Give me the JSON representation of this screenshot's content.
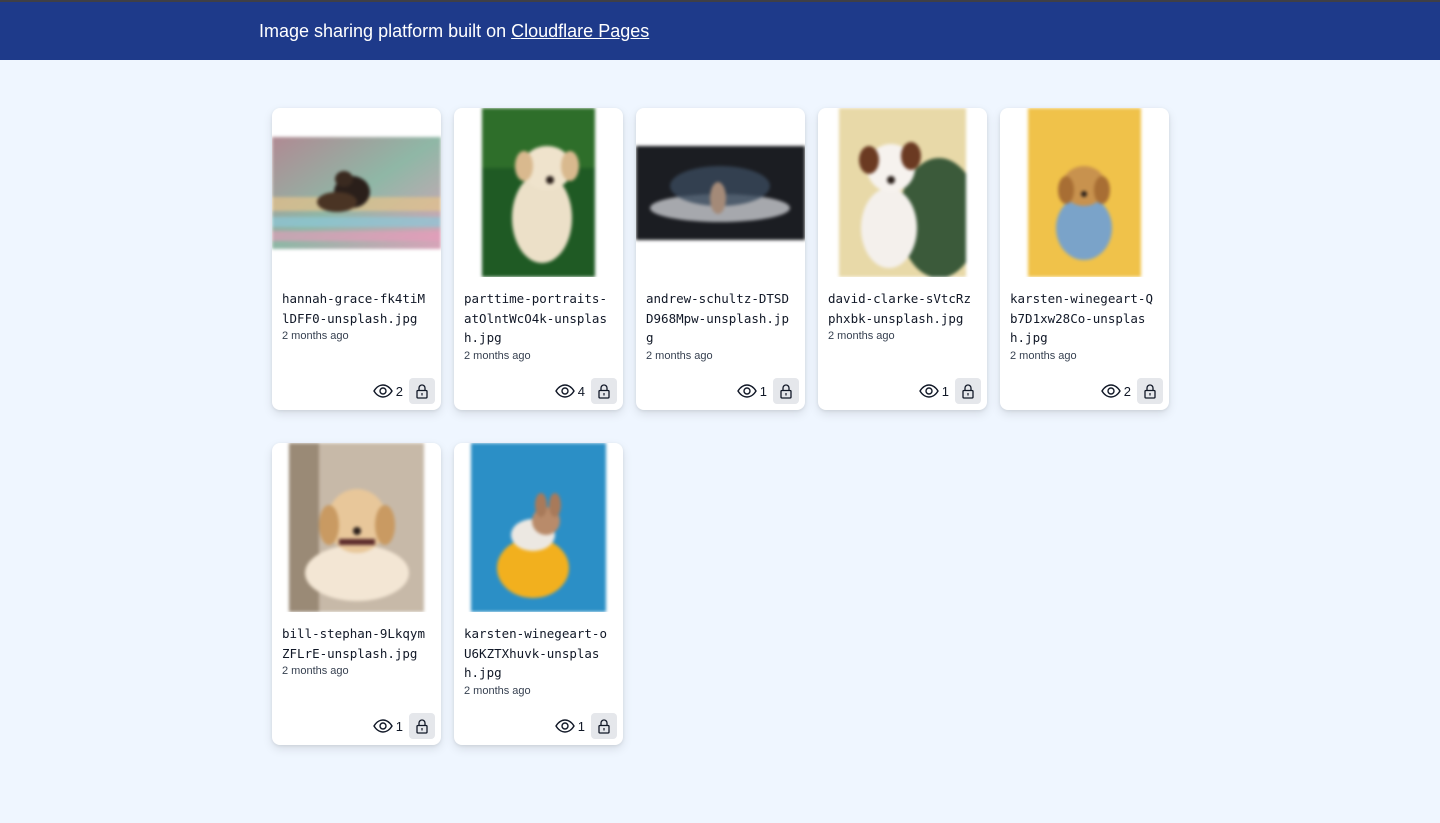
{
  "header": {
    "text_prefix": "Image sharing platform built on ",
    "link_text": "Cloudflare Pages"
  },
  "images": [
    {
      "filename": "hannah-grace-fk4tiMlDFF0-unsplash.jpg",
      "date": "2 months ago",
      "views": "2"
    },
    {
      "filename": "parttime-portraits-atOlntWcO4k-unsplash.jpg",
      "date": "2 months ago",
      "views": "4"
    },
    {
      "filename": "andrew-schultz-DTSDD968Mpw-unsplash.jpg",
      "date": "2 months ago",
      "views": "1"
    },
    {
      "filename": "david-clarke-sVtcRzphxbk-unsplash.jpg",
      "date": "2 months ago",
      "views": "1"
    },
    {
      "filename": "karsten-winegeart-Qb7D1xw28Co-unsplash.jpg",
      "date": "2 months ago",
      "views": "2"
    },
    {
      "filename": "bill-stephan-9LkqymZFLrE-unsplash.jpg",
      "date": "2 months ago",
      "views": "1"
    },
    {
      "filename": "karsten-winegeart-oU6KZTXhuvk-unsplash.jpg",
      "date": "2 months ago",
      "views": "1"
    }
  ],
  "icons": {
    "views": "eye-icon",
    "lock": "lock-icon"
  },
  "colors": {
    "header_bg": "#1e3a8a",
    "page_bg": "#eff6ff",
    "card_bg": "#ffffff"
  }
}
